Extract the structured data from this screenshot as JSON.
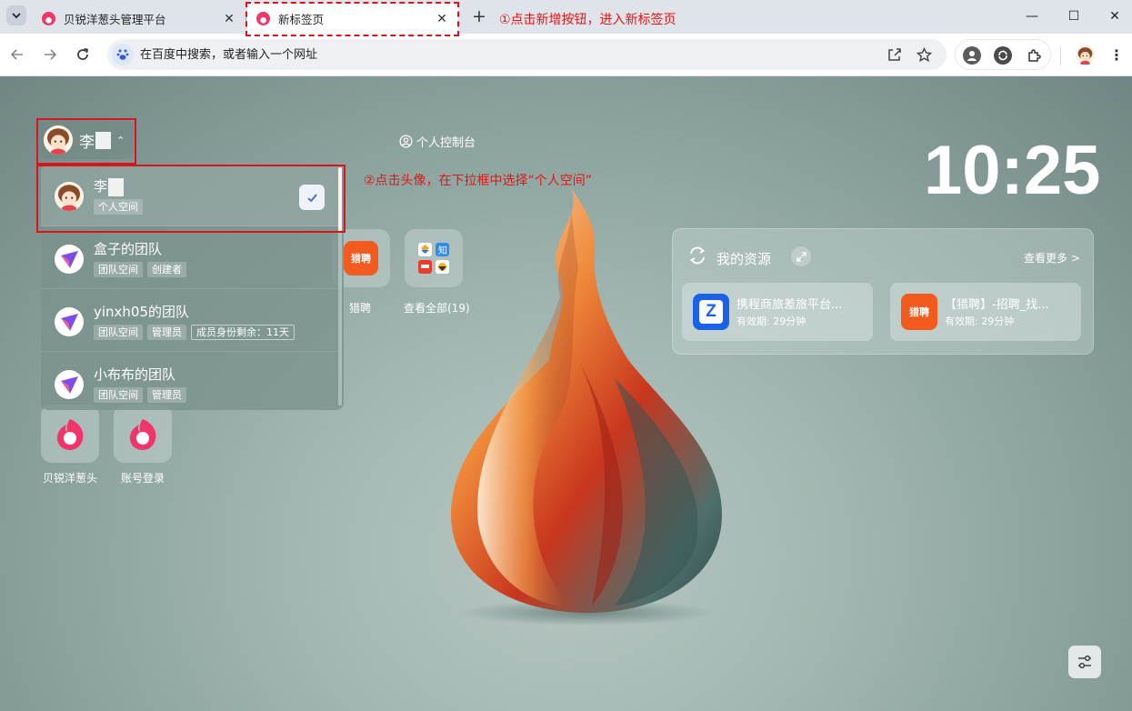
{
  "browser": {
    "tabs": [
      {
        "title": "贝锐洋葱头管理平台",
        "active": false
      },
      {
        "title": "新标签页",
        "active": true
      }
    ],
    "new_tab_symbol": "+",
    "window_controls": {
      "minimize": "—",
      "maximize": "☐",
      "close": "✕"
    },
    "omnibox": {
      "placeholder": "在百度中搜索，或者输入一个网址",
      "value": ""
    },
    "icons": [
      "back-icon",
      "forward-icon",
      "reload-icon",
      "baidu-icon",
      "share-icon",
      "star-icon",
      "profile-ext-icon",
      "sync-icon",
      "extensions-icon",
      "menu-icon"
    ]
  },
  "annotations": {
    "step1": "①点击新增按钮，进入新标签页",
    "step2": "②点击头像，在下拉框中选择“个人空间”",
    "color": "#e01616"
  },
  "user_chip": {
    "name": "李",
    "caret": "⌃"
  },
  "console_link": "个人控制台",
  "clock": "10:25",
  "dropdown": {
    "items": [
      {
        "name": "李",
        "tags": [
          "个人空间"
        ],
        "selected": true
      },
      {
        "name": "盒子的团队",
        "tags": [
          "团队空间",
          "创建者"
        ],
        "selected": false
      },
      {
        "name": "yinxh05的团队",
        "tags": [
          "团队空间",
          "管理员"
        ],
        "extra_tag": "成员身份剩余：11天",
        "selected": false
      },
      {
        "name": "小布布的团队",
        "tags": [
          "团队空间",
          "管理员"
        ],
        "selected": false
      }
    ]
  },
  "apps": [
    {
      "label": "猎聘",
      "icon_text": "猎聘"
    },
    {
      "label": "查看全部(19)"
    },
    {
      "label": "贝锐洋葱头"
    },
    {
      "label": "账号登录"
    }
  ],
  "resources": {
    "title": "我的资源",
    "more": "查看更多 >",
    "items": [
      {
        "name": "携程商旅差旅平台...",
        "expiry": "有效期: 29分钟",
        "logo_text": "Z",
        "logo_color": "#1b62e6"
      },
      {
        "name": "【猎聘】-招聘_找...",
        "expiry": "有效期: 29分钟",
        "logo_text": "猎聘",
        "logo_color": "#f25b1d"
      }
    ]
  },
  "colors": {
    "accent_red": "#f0356b",
    "check_blue": "#3a64d8"
  }
}
